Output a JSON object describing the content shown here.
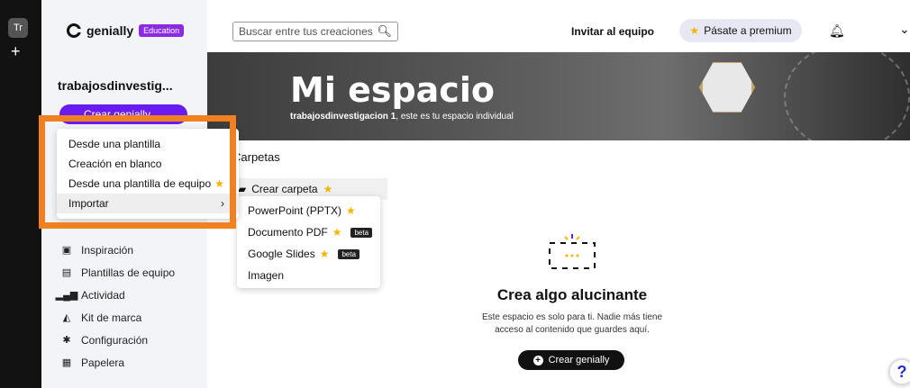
{
  "rail": {
    "avatar_label": "Tr",
    "add_label": "+"
  },
  "logo": {
    "name": "genially",
    "badge": "Education"
  },
  "sidebar": {
    "workspace_name": "trabajosdinvestig...",
    "create_button": "Crear genially",
    "nav": [
      {
        "label": "Inspiración",
        "icon": "inspiration-icon"
      },
      {
        "label": "Plantillas de equipo",
        "icon": "team-templates-icon"
      },
      {
        "label": "Actividad",
        "icon": "activity-icon"
      },
      {
        "label": "Kit de marca",
        "icon": "brand-kit-icon"
      },
      {
        "label": "Configuración",
        "icon": "gear-icon"
      },
      {
        "label": "Papelera",
        "icon": "trash-icon"
      }
    ]
  },
  "topbar": {
    "search_placeholder": "Buscar entre tus creaciones",
    "invite": "Invitar al equipo",
    "premium": "Pásate a premium"
  },
  "hero": {
    "title": "Mi espacio",
    "subtitle_user": "trabajosdinvestigacion 1",
    "subtitle_rest": ", este es tu espacio individual"
  },
  "folders": {
    "heading": "Carpetas",
    "create_folder": "Crear carpeta"
  },
  "create_menu": {
    "items": [
      {
        "label": "Desde una plantilla"
      },
      {
        "label": "Creación en blanco"
      },
      {
        "label": "Desde una plantilla de equipo"
      },
      {
        "label": "Importar"
      }
    ]
  },
  "import_menu": {
    "items": [
      {
        "label": "PowerPoint (PPTX)"
      },
      {
        "label": "Documento PDF",
        "badge": "beta"
      },
      {
        "label": "Google Slides",
        "badge": "beta"
      },
      {
        "label": "Imagen"
      }
    ]
  },
  "empty_state": {
    "title": "Crea algo alucinante",
    "desc_line1": "Este espacio es solo para ti. Nadie más tiene",
    "desc_line2": "acceso al contenido que guardes aquí.",
    "button": "Crear genially"
  },
  "help": "?",
  "colors": {
    "accent": "#6a1cf0",
    "highlight": "#f08020",
    "star": "#f4b400"
  }
}
